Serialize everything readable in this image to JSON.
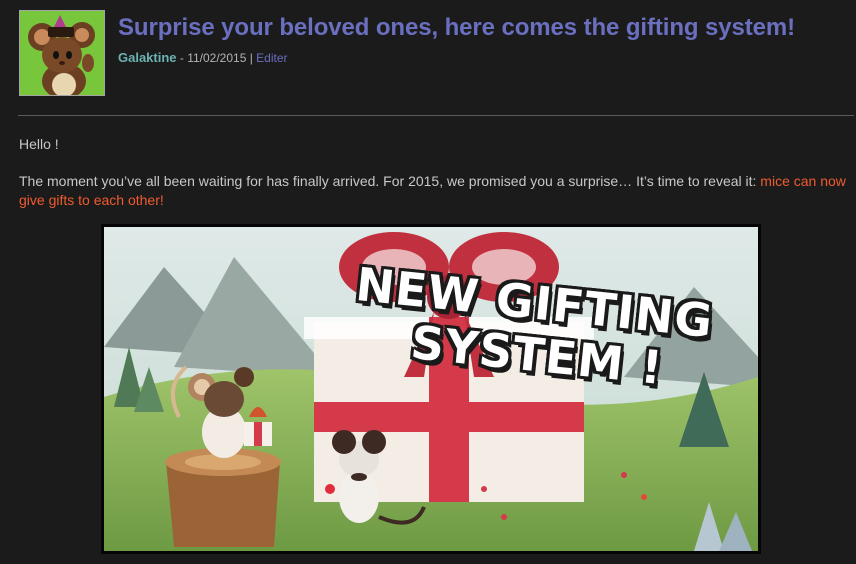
{
  "post": {
    "title": "Surprise your beloved ones, here comes the gifting system!",
    "author": "Galaktine",
    "date_prefix": " - ",
    "date": "11/02/2015",
    "separator": " | ",
    "edit_label": "Editer"
  },
  "body": {
    "greeting": "Hello !",
    "paragraph_text": "The moment you’ve all been waiting for has finally arrived. For 2015, we promised you a surprise… It’s time to reveal it: ",
    "paragraph_highlight": "mice can now give gifts to each other!"
  },
  "banner": {
    "line1": "NEW GIFTING",
    "line2": "SYSTEM !"
  },
  "colors": {
    "background": "#1b1b1b",
    "title": "#6a6fc0",
    "author": "#6bb3b3",
    "highlight": "#ef5b2f",
    "text": "#c8c8c8"
  }
}
